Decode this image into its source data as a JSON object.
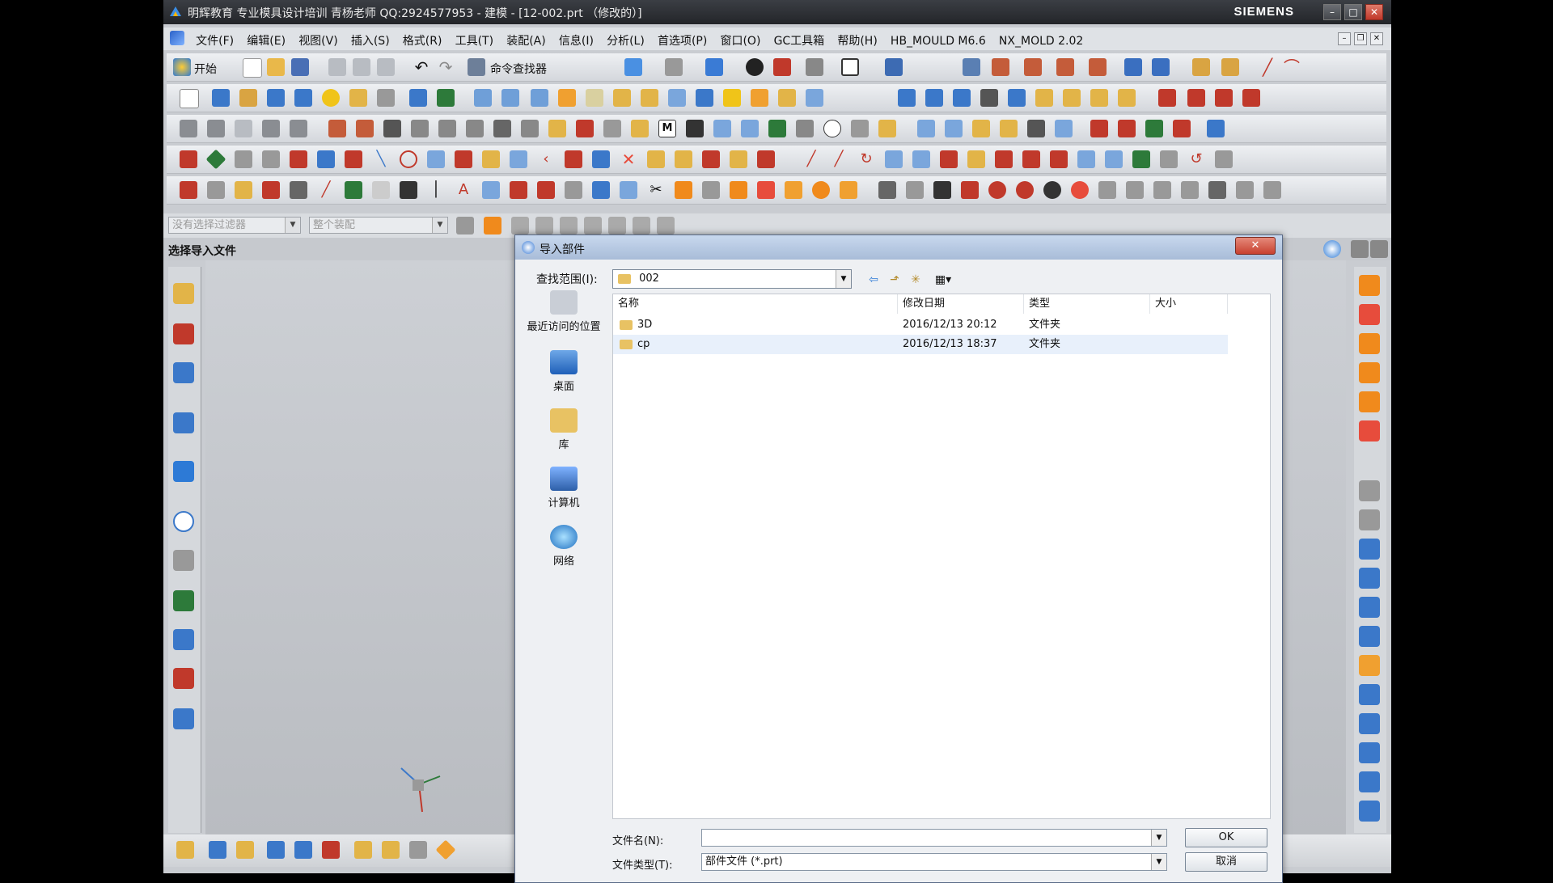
{
  "window": {
    "title": "明辉教育 专业模具设计培训 青杨老师  QQ:2924577953 - 建模 - [12-002.prt （修改的）]",
    "brand": "SIEMENS"
  },
  "menubar": {
    "items": [
      "文件(F)",
      "编辑(E)",
      "视图(V)",
      "插入(S)",
      "格式(R)",
      "工具(T)",
      "装配(A)",
      "信息(I)",
      "分析(L)",
      "首选项(P)",
      "窗口(O)",
      "GC工具箱",
      "帮助(H)",
      "HB_MOULD M6.6",
      "NX_MOLD 2.02"
    ]
  },
  "toolbar": {
    "start_label": "开始",
    "command_finder_label": "命令查找器"
  },
  "filter": {
    "selection_filter": "没有选择过滤器",
    "assembly_scope": "整个装配"
  },
  "resource_bar": {
    "header": "选择导入文件"
  },
  "dialog": {
    "title": "导入部件",
    "look_in_label": "查找范围(I):",
    "look_in_value": "002",
    "places": [
      "最近访问的位置",
      "桌面",
      "库",
      "计算机",
      "网络"
    ],
    "columns": [
      "名称",
      "修改日期",
      "类型",
      "大小"
    ],
    "files": [
      {
        "name": "3D",
        "date": "2016/12/13 20:12",
        "type": "文件夹",
        "size": ""
      },
      {
        "name": "cp",
        "date": "2016/12/13 18:37",
        "type": "文件夹",
        "size": ""
      }
    ],
    "filename_label": "文件名(N):",
    "filename_value": "",
    "filetype_label": "文件类型(T):",
    "filetype_value": "部件文件 (*.prt)",
    "ok_label": "OK",
    "cancel_label": "取消"
  },
  "colors": {
    "titlebar": "#2e3136",
    "dialog_title": "#b6c8e2",
    "close_red": "#c8402f",
    "folder": "#e8c263",
    "highlight": "#ffdc00"
  }
}
